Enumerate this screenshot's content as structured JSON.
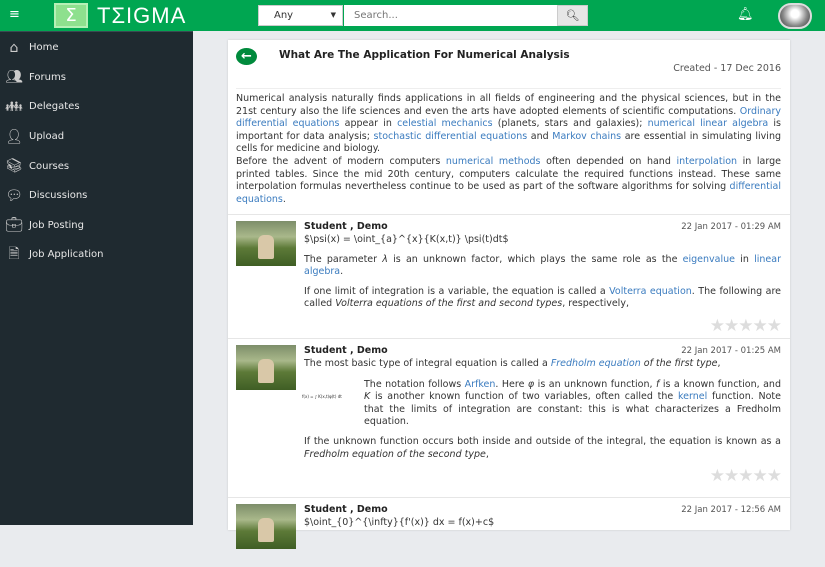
{
  "header": {
    "logo_text": "TΣIGMA",
    "logo_symbol": "Σ",
    "filter": "Any",
    "search_placeholder": "Search..."
  },
  "sidebar": {
    "items": [
      {
        "label": "Home",
        "icon": "home-icon"
      },
      {
        "label": "Forums",
        "icon": "forums-icon"
      },
      {
        "label": "Delegates",
        "icon": "delegates-icon"
      },
      {
        "label": "Upload",
        "icon": "upload-icon"
      },
      {
        "label": "Courses",
        "icon": "courses-icon"
      },
      {
        "label": "Discussions",
        "icon": "discussions-icon"
      },
      {
        "label": "Job Posting",
        "icon": "briefcase-icon"
      },
      {
        "label": "Job Application",
        "icon": "document-icon"
      }
    ]
  },
  "thread": {
    "title": "What Are The Application For Numerical Analysis",
    "created": "Created - 17 Dec 2016",
    "intro": [
      {
        "t": "Numerical analysis naturally finds applications in all fields of engineering and the physical sciences, but in the 21st century also the life sciences and even the arts have adopted elements of scientific computations. "
      },
      {
        "t": "Ordinary differential equations",
        "k": "link"
      },
      {
        "t": " appear in "
      },
      {
        "t": "celestial mechanics",
        "k": "link"
      },
      {
        "t": " (planets, stars and galaxies); "
      },
      {
        "t": "numerical linear algebra",
        "k": "link"
      },
      {
        "t": " is important for data analysis; "
      },
      {
        "t": "stochastic differential equations",
        "k": "link"
      },
      {
        "t": " and "
      },
      {
        "t": "Markov chains",
        "k": "link"
      },
      {
        "t": " are essential in simulating living cells for medicine and biology."
      },
      {
        "k": "br"
      },
      {
        "t": "Before the advent of modern computers "
      },
      {
        "t": "numerical methods",
        "k": "link"
      },
      {
        "t": " often depended on hand "
      },
      {
        "t": "interpolation",
        "k": "link"
      },
      {
        "t": " in large printed tables. Since the mid 20th century, computers calculate the required functions instead. These same interpolation formulas nevertheless continue to be used as part of the software algorithms for solving "
      },
      {
        "t": "differential equations",
        "k": "link"
      },
      {
        "t": "."
      }
    ]
  },
  "posts": [
    {
      "author": "Student , Demo",
      "date": "22 Jan 2017 - 01:29 AM",
      "paras": [
        [
          {
            "t": "$\\psi(x) = \\oint_{a}^{x}{K(x,t)} \\psi(t)dt$"
          }
        ],
        [
          {
            "t": "The parameter "
          },
          {
            "t": "λ",
            "k": "it"
          },
          {
            "t": " is an unknown factor, which plays the same role as the "
          },
          {
            "t": "eigenvalue",
            "k": "link"
          },
          {
            "t": " in "
          },
          {
            "t": "linear algebra",
            "k": "link"
          },
          {
            "t": "."
          }
        ],
        [
          {
            "t": "If one limit of integration is a variable, the equation is called a "
          },
          {
            "t": "Volterra equation",
            "k": "link"
          },
          {
            "t": ". The following are called "
          },
          {
            "t": "Volterra equations of the first and second types",
            "k": "it"
          },
          {
            "t": ", respectively,"
          }
        ]
      ]
    },
    {
      "author": "Student , Demo",
      "date": "22 Jan 2017 - 01:25 AM",
      "formula": "f(x) = ∫ K(x,t)φ(t) dt",
      "paras": [
        [
          {
            "t": "The most basic type of integral equation is called a "
          },
          {
            "t": "Fredholm equation",
            "k": "itlink"
          },
          {
            "t": " of the first type",
            "k": "it"
          },
          {
            "t": ","
          }
        ],
        [
          {
            "t": "The notation follows "
          },
          {
            "t": "Arfken",
            "k": "link"
          },
          {
            "t": ". Here "
          },
          {
            "t": "φ",
            "k": "it"
          },
          {
            "t": " is an unknown function, "
          },
          {
            "t": "f",
            "k": "it"
          },
          {
            "t": " is a known function, and "
          },
          {
            "t": "K",
            "k": "it"
          },
          {
            "t": " is another known function of two variables, often called the "
          },
          {
            "t": "kernel",
            "k": "link"
          },
          {
            "t": " function. Note that the limits of integration are constant: this is what characterizes a Fredholm equation."
          }
        ],
        [
          {
            "t": "If the unknown function occurs both inside and outside of the integral, the equation is known as a "
          },
          {
            "t": "Fredholm equation of the second type",
            "k": "it"
          },
          {
            "t": ","
          }
        ]
      ]
    },
    {
      "author": "Student , Demo",
      "date": "22 Jan 2017 - 12:56 AM",
      "paras": [
        [
          {
            "t": "$\\oint_{0}^{\\infty}{f'(x)} dx = f(x)+c$"
          }
        ]
      ]
    }
  ],
  "colors": {
    "brand": "#00a651",
    "sidebar": "#1f2a30",
    "link": "#3a7bbf"
  }
}
